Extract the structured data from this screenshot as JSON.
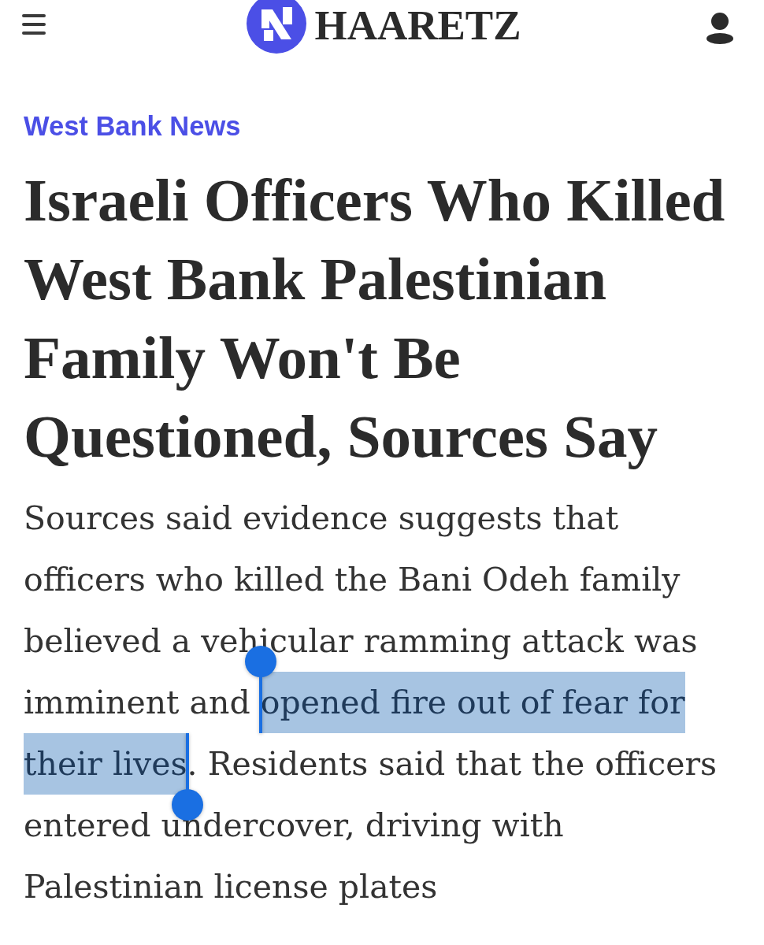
{
  "header": {
    "logo": "HAARETZ"
  },
  "article": {
    "section": "West Bank News",
    "headline": "Israeli Officers Who Killed West Bank Palestinian Family Won't Be Questioned, Sources Say",
    "summary": [
      {
        "text": "Sources said evidence suggests that officers who killed the Bani Odeh family believed a vehicular ramming attack was imminent and ",
        "selected": false
      },
      {
        "text": "opened fire out of fear for their lives",
        "selected": true
      },
      {
        "text": ". Residents said that the officers entered undercover, driving with Palestinian license plates",
        "selected": false
      }
    ]
  }
}
